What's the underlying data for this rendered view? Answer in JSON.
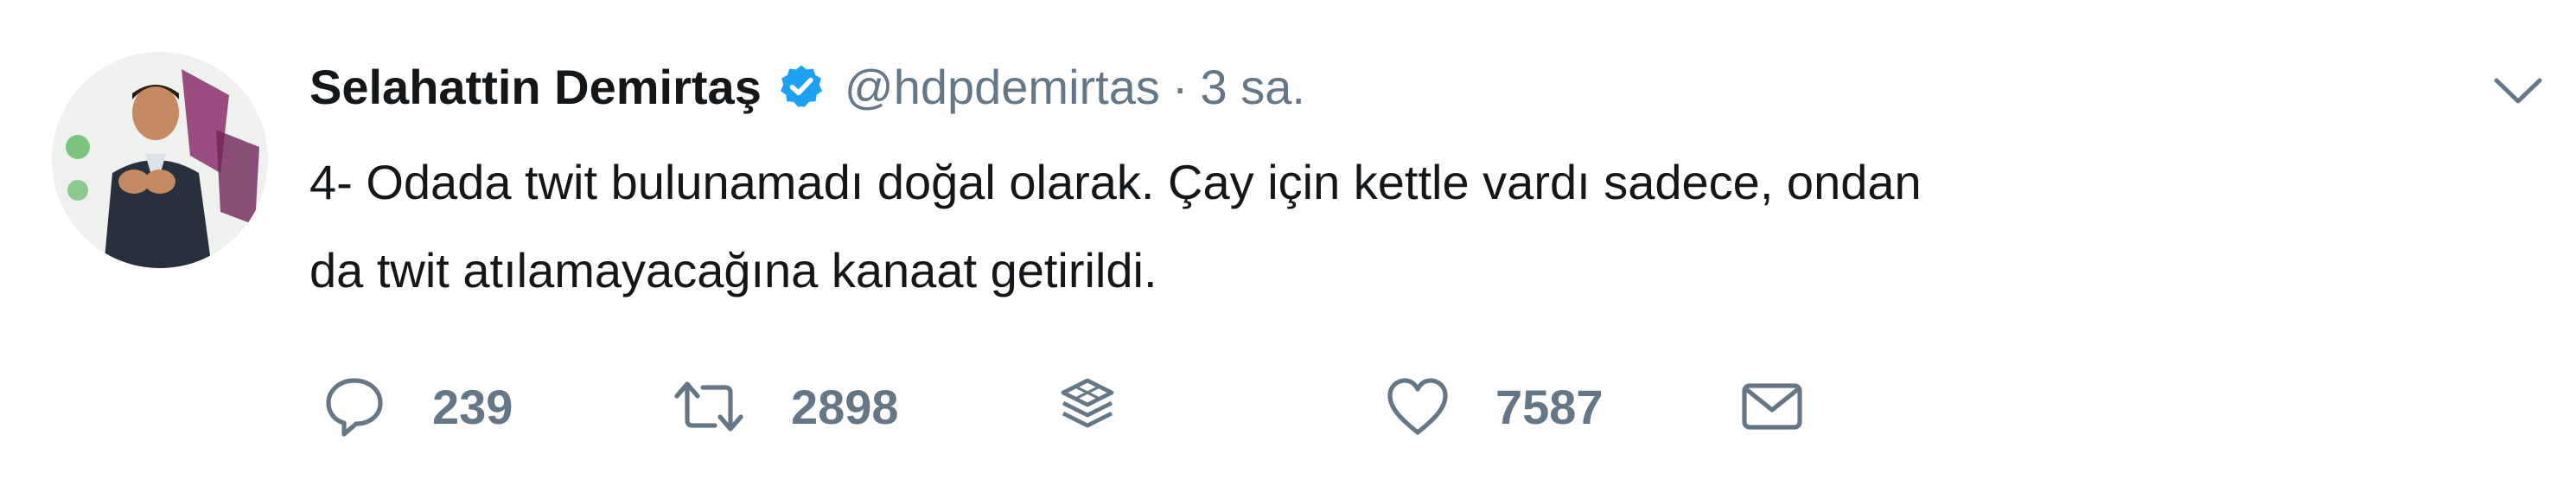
{
  "tweet": {
    "author_name": "Selahattin Demirtaş",
    "handle": "@hdpdemirtas",
    "separator": "·",
    "time": "3 sa.",
    "text_lines": [
      "4- Odada twit bulunamadı doğal olarak. Çay için kettle vardı sadece, ondan",
      "da twit atılamayacağına kanaat getirildi."
    ]
  },
  "actions": {
    "reply_count": "239",
    "retweet_count": "2898",
    "like_count": "7587"
  },
  "icons": {
    "verified": "verified-badge-icon",
    "caret": "chevron-down-icon",
    "reply": "reply-icon",
    "retweet": "retweet-icon",
    "analytics": "stack-icon",
    "like": "heart-icon",
    "message": "envelope-icon"
  },
  "colors": {
    "text": "#14171a",
    "secondary": "#657786",
    "verified_blue": "#1da1f2",
    "background": "#ffffff"
  }
}
